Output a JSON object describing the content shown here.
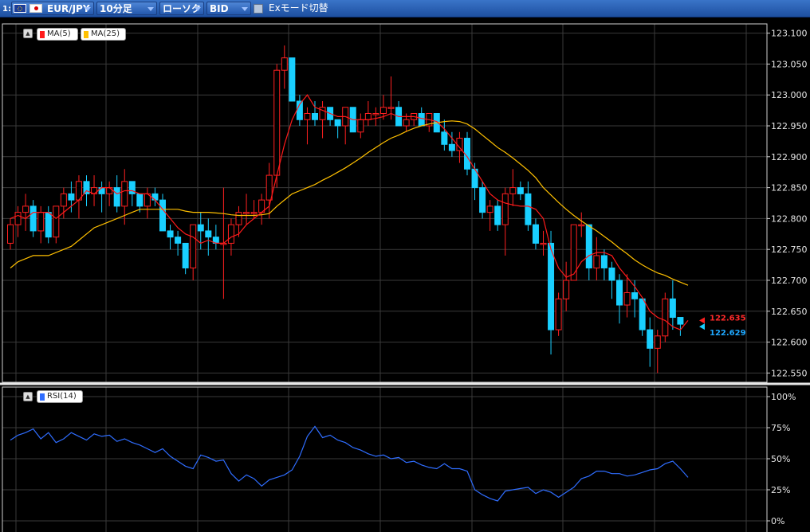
{
  "toolbar": {
    "slot": "1:",
    "pair": "EUR/JPY",
    "timeframe": "10分足",
    "chart_type": "ローソク",
    "price_type": "BID",
    "ex_mode": "Exモード切替"
  },
  "legend": {
    "ma5": "MA(5)",
    "ma25": "MA(25)",
    "rsi": "RSI(14)",
    "ma5_color": "#ff1a1a",
    "ma25_color": "#ffc000",
    "rsi_color": "#2f6dff"
  },
  "colors": {
    "bull_body": "#000000",
    "bull_outline": "#ff2020",
    "bear_body": "#19cfff",
    "grid": "#3a3a3a",
    "frame": "#d0d0d0"
  },
  "price_axis": [
    "123.100",
    "123.050",
    "123.000",
    "122.950",
    "122.900",
    "122.850",
    "122.800",
    "122.750",
    "122.700",
    "122.650",
    "122.600",
    "122.550"
  ],
  "rsi_axis": [
    "100%",
    "75%",
    "50%",
    "25%",
    "0%"
  ],
  "last_prices": {
    "ma5": "122.635",
    "last": "122.629"
  },
  "chart_data": {
    "type": "candlestick",
    "ylim": [
      122.535,
      123.115
    ],
    "rsi_ylim": [
      0,
      100
    ],
    "candles": [
      [
        122.76,
        122.8,
        122.75,
        122.79
      ],
      [
        122.79,
        122.82,
        122.77,
        122.81
      ],
      [
        122.81,
        122.84,
        122.78,
        122.82
      ],
      [
        122.82,
        122.83,
        122.77,
        122.78
      ],
      [
        122.78,
        122.82,
        122.76,
        122.81
      ],
      [
        122.81,
        122.82,
        122.76,
        122.77
      ],
      [
        122.77,
        122.82,
        122.76,
        122.82
      ],
      [
        122.82,
        122.85,
        122.8,
        122.84
      ],
      [
        122.84,
        122.86,
        122.81,
        122.83
      ],
      [
        122.83,
        122.87,
        122.8,
        122.86
      ],
      [
        122.86,
        122.87,
        122.82,
        122.84
      ],
      [
        122.84,
        122.87,
        122.82,
        122.85
      ],
      [
        122.85,
        122.86,
        122.81,
        122.84
      ],
      [
        122.84,
        122.86,
        122.82,
        122.85
      ],
      [
        122.85,
        122.87,
        122.81,
        122.82
      ],
      [
        122.82,
        122.88,
        122.79,
        122.86
      ],
      [
        122.86,
        122.86,
        122.82,
        122.84
      ],
      [
        122.84,
        122.84,
        122.81,
        122.82
      ],
      [
        122.82,
        122.85,
        122.8,
        122.84
      ],
      [
        122.84,
        122.85,
        122.82,
        122.83
      ],
      [
        122.83,
        122.84,
        122.78,
        122.78
      ],
      [
        122.78,
        122.79,
        122.75,
        122.77
      ],
      [
        122.77,
        122.78,
        122.74,
        122.76
      ],
      [
        122.76,
        122.76,
        122.71,
        122.72
      ],
      [
        122.72,
        122.79,
        122.7,
        122.79
      ],
      [
        122.79,
        122.81,
        122.75,
        122.78
      ],
      [
        122.78,
        122.8,
        122.74,
        122.77
      ],
      [
        122.77,
        122.79,
        122.75,
        122.76
      ],
      [
        122.76,
        122.85,
        122.67,
        122.76
      ],
      [
        122.76,
        122.8,
        122.74,
        122.79
      ],
      [
        122.79,
        122.82,
        122.77,
        122.81
      ],
      [
        122.81,
        122.84,
        122.79,
        122.81
      ],
      [
        122.81,
        122.83,
        122.8,
        122.81
      ],
      [
        122.81,
        122.84,
        122.79,
        122.83
      ],
      [
        122.83,
        122.89,
        122.8,
        122.87
      ],
      [
        122.87,
        123.05,
        122.85,
        123.04
      ],
      [
        123.04,
        123.08,
        123.01,
        123.06
      ],
      [
        123.06,
        123.06,
        122.99,
        122.99
      ],
      [
        122.99,
        123.0,
        122.95,
        122.96
      ],
      [
        122.96,
        122.98,
        122.92,
        122.97
      ],
      [
        122.97,
        122.99,
        122.95,
        122.96
      ],
      [
        122.96,
        122.99,
        122.93,
        122.98
      ],
      [
        122.98,
        122.98,
        122.95,
        122.96
      ],
      [
        122.96,
        122.96,
        122.93,
        122.95
      ],
      [
        122.95,
        122.98,
        122.92,
        122.98
      ],
      [
        122.98,
        122.98,
        122.94,
        122.94
      ],
      [
        122.94,
        122.97,
        122.93,
        122.96
      ],
      [
        122.96,
        122.99,
        122.95,
        122.97
      ],
      [
        122.97,
        122.98,
        122.95,
        122.97
      ],
      [
        122.97,
        123.0,
        122.96,
        122.98
      ],
      [
        122.98,
        123.03,
        122.96,
        122.98
      ],
      [
        122.98,
        122.99,
        122.95,
        122.95
      ],
      [
        122.95,
        122.97,
        122.94,
        122.96
      ],
      [
        122.96,
        122.97,
        122.95,
        122.97
      ],
      [
        122.97,
        122.98,
        122.95,
        122.95
      ],
      [
        122.95,
        122.97,
        122.94,
        122.97
      ],
      [
        122.97,
        122.97,
        122.94,
        122.94
      ],
      [
        122.94,
        122.96,
        122.91,
        122.92
      ],
      [
        122.92,
        122.94,
        122.9,
        122.91
      ],
      [
        122.91,
        122.94,
        122.89,
        122.93
      ],
      [
        122.93,
        122.94,
        122.87,
        122.88
      ],
      [
        122.88,
        122.89,
        122.83,
        122.85
      ],
      [
        122.85,
        122.86,
        122.8,
        122.81
      ],
      [
        122.81,
        122.83,
        122.78,
        122.82
      ],
      [
        122.82,
        122.83,
        122.78,
        122.79
      ],
      [
        122.79,
        122.85,
        122.74,
        122.84
      ],
      [
        122.84,
        122.88,
        122.82,
        122.85
      ],
      [
        122.85,
        122.86,
        122.83,
        122.84
      ],
      [
        122.84,
        122.86,
        122.78,
        122.79
      ],
      [
        122.79,
        122.8,
        122.75,
        122.76
      ],
      [
        122.76,
        122.78,
        122.74,
        122.76
      ],
      [
        122.76,
        122.78,
        122.58,
        122.62
      ],
      [
        122.62,
        122.68,
        122.61,
        122.67
      ],
      [
        122.67,
        122.73,
        122.65,
        122.7
      ],
      [
        122.7,
        122.77,
        122.7,
        122.79
      ],
      [
        122.79,
        122.81,
        122.77,
        122.79
      ],
      [
        122.79,
        122.79,
        122.7,
        122.72
      ],
      [
        122.72,
        122.77,
        122.7,
        122.74
      ],
      [
        122.74,
        122.75,
        122.7,
        122.72
      ],
      [
        122.72,
        122.73,
        122.67,
        122.7
      ],
      [
        122.7,
        122.71,
        122.63,
        122.66
      ],
      [
        122.66,
        122.71,
        122.64,
        122.68
      ],
      [
        122.68,
        122.7,
        122.64,
        122.67
      ],
      [
        122.67,
        122.67,
        122.61,
        122.62
      ],
      [
        122.62,
        122.64,
        122.56,
        122.59
      ],
      [
        122.59,
        122.62,
        122.55,
        122.61
      ],
      [
        122.61,
        122.68,
        122.6,
        122.67
      ],
      [
        122.67,
        122.7,
        122.62,
        122.64
      ],
      [
        122.64,
        122.64,
        122.61,
        122.629
      ]
    ],
    "ma5": [
      122.8,
      122.805,
      122.8,
      122.81,
      122.81,
      122.81,
      122.8,
      122.81,
      122.82,
      122.83,
      122.845,
      122.84,
      122.85,
      122.85,
      122.84,
      122.845,
      122.845,
      122.84,
      122.84,
      122.83,
      122.815,
      122.8,
      122.785,
      122.775,
      122.77,
      122.76,
      122.765,
      122.76,
      122.76,
      122.77,
      122.775,
      122.79,
      122.8,
      122.81,
      122.82,
      122.87,
      122.92,
      122.96,
      122.985,
      123.0,
      122.98,
      122.975,
      122.97,
      122.965,
      122.965,
      122.96,
      122.96,
      122.96,
      122.962,
      122.965,
      122.97,
      122.965,
      122.965,
      122.965,
      122.962,
      122.96,
      122.957,
      122.945,
      122.93,
      122.915,
      122.9,
      122.88,
      122.86,
      122.84,
      122.83,
      122.825,
      122.822,
      122.82,
      122.82,
      122.815,
      122.8,
      122.75,
      122.72,
      122.705,
      122.71,
      122.73,
      122.74,
      122.745,
      122.745,
      122.74,
      122.72,
      122.705,
      122.69,
      122.672,
      122.65,
      122.64,
      122.635,
      122.625,
      122.62,
      122.635
    ],
    "ma25": [
      122.72,
      122.73,
      122.735,
      122.74,
      122.74,
      122.74,
      122.745,
      122.75,
      122.755,
      122.765,
      122.775,
      122.785,
      122.79,
      122.795,
      122.8,
      122.805,
      122.81,
      122.815,
      122.815,
      122.815,
      122.815,
      122.815,
      122.815,
      122.812,
      122.81,
      122.81,
      122.81,
      122.809,
      122.808,
      122.806,
      122.805,
      122.805,
      122.805,
      122.806,
      122.808,
      122.82,
      122.83,
      122.84,
      122.845,
      122.85,
      122.855,
      122.862,
      122.868,
      122.875,
      122.882,
      122.89,
      122.898,
      122.907,
      122.915,
      122.923,
      122.93,
      122.935,
      122.941,
      122.946,
      122.95,
      122.953,
      122.955,
      122.957,
      122.958,
      122.957,
      122.953,
      122.945,
      122.935,
      122.925,
      122.915,
      122.907,
      122.898,
      122.888,
      122.878,
      122.866,
      122.85,
      122.838,
      122.826,
      122.815,
      122.805,
      122.796,
      122.788,
      122.78,
      122.771,
      122.762,
      122.752,
      122.743,
      122.733,
      122.725,
      122.718,
      122.712,
      122.708,
      122.702,
      122.697,
      122.692
    ],
    "rsi": [
      65,
      69,
      71,
      74,
      66,
      71,
      63,
      66,
      71,
      68,
      65,
      70,
      68,
      69,
      64,
      66,
      63,
      61,
      58,
      55,
      58,
      52,
      48,
      44,
      42,
      53,
      51,
      48,
      49,
      38,
      32,
      37,
      34,
      28,
      33,
      35,
      37,
      41,
      52,
      68,
      76,
      67,
      69,
      65,
      63,
      59,
      57,
      54,
      52,
      53,
      50,
      51,
      47,
      48,
      45,
      43,
      42,
      46,
      42,
      42,
      40,
      25,
      21,
      18,
      16,
      24,
      25,
      26,
      27,
      22,
      25,
      23,
      19,
      23,
      27,
      34,
      36,
      40,
      40,
      38,
      38,
      36,
      37,
      39,
      41,
      42,
      46,
      48,
      42,
      35
    ]
  }
}
